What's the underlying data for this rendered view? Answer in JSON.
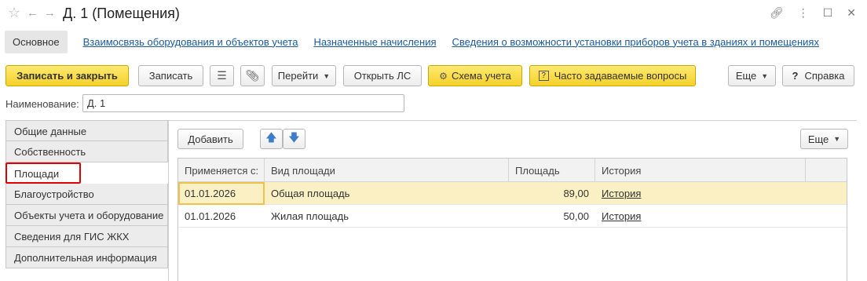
{
  "window": {
    "title": "Д. 1 (Помещения)"
  },
  "nav_tabs": {
    "active": "Основное",
    "links": [
      "Взаимосвязь оборудования и объектов учета",
      "Назначенные начисления",
      "Сведения о возможности установки приборов учета в зданиях и помещениях"
    ]
  },
  "toolbar": {
    "save_close": "Записать и закрыть",
    "save": "Записать",
    "goto": "Перейти",
    "open_ls": "Открыть ЛС",
    "scheme": "Схема учета",
    "faq": "Часто задаваемые вопросы",
    "more": "Еще",
    "help": "Справка"
  },
  "form": {
    "name_label": "Наименование:",
    "name_value": "Д. 1"
  },
  "sidebar": {
    "items": [
      "Общие данные",
      "Собственность",
      "Площади",
      "Благоустройство",
      "Объекты учета и оборудование",
      "Сведения для ГИС ЖКХ",
      "Дополнительная информация"
    ]
  },
  "panel": {
    "add": "Добавить",
    "more": "Еще"
  },
  "table": {
    "headers": [
      "Применяется с:",
      "Вид площади",
      "Площадь",
      "История"
    ],
    "rows": [
      {
        "date": "01.01.2026",
        "type": "Общая площадь",
        "area": "89,00",
        "history": "История"
      },
      {
        "date": "01.01.2026",
        "type": "Жилая площадь",
        "area": "50,00",
        "history": "История"
      }
    ]
  },
  "colors": {
    "accent_yellow": "#f5d12a",
    "link_blue": "#1c5a9e",
    "highlight_red": "#e00000",
    "selected_row": "#fbf0c4"
  }
}
